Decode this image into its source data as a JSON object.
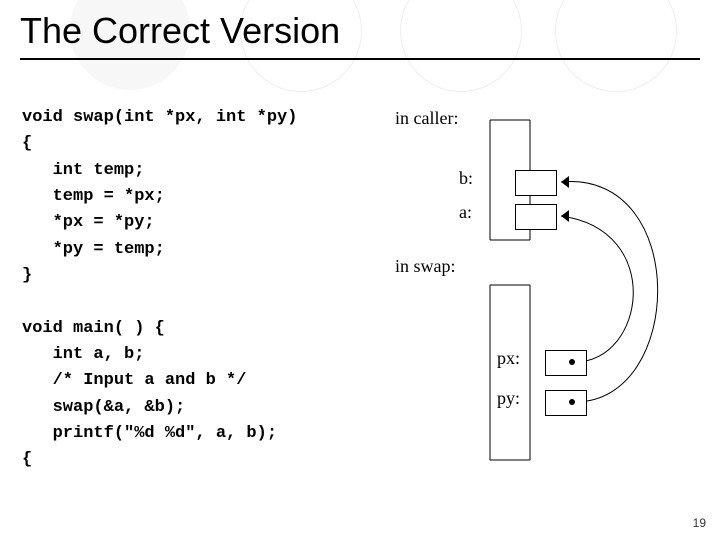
{
  "slide": {
    "title": "The Correct Version",
    "number": "19"
  },
  "code": {
    "swap_sig": "void swap(int *px, int *py)",
    "open1": "{",
    "l1": "   int temp;",
    "l2": "   temp = *px;",
    "l3": "   *px = *py;",
    "l4": "   *py = temp;",
    "close1": "}",
    "main_sig": "void main( ) {",
    "m1": "   int a, b;",
    "m2": "   /* Input a and b */",
    "m3": "   swap(&a, &b);",
    "m4": "   printf(\"%d %d\", a, b);",
    "close2": "{"
  },
  "diagram": {
    "in_caller": "in caller:",
    "b": "b:",
    "a": "a:",
    "in_swap": "in swap:",
    "px": "px:",
    "py": "py:"
  }
}
